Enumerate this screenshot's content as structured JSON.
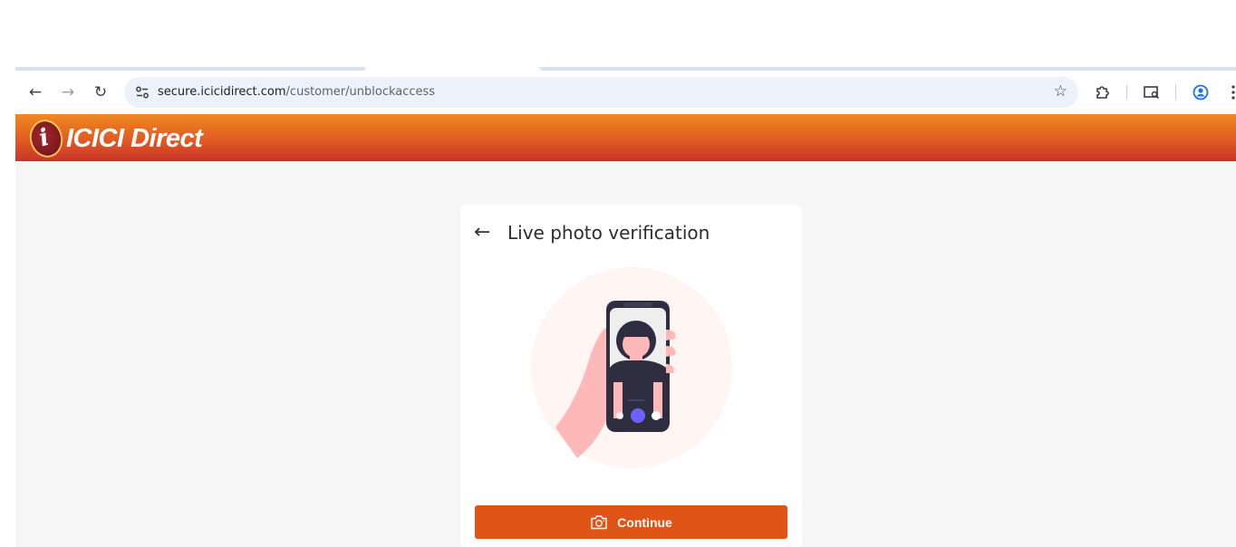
{
  "browser": {
    "url_host": "secure.icicidirect.com",
    "url_path": "/customer/unblockaccess",
    "icons": {
      "back": "back-arrow-icon",
      "forward": "forward-arrow-icon",
      "reload": "reload-icon",
      "site_info": "tune-icon",
      "bookmark": "star-icon",
      "extensions": "puzzle-icon",
      "tab_search": "tab-search-icon",
      "profile": "profile-icon",
      "menu": "kebab-menu-icon"
    }
  },
  "header": {
    "logo_text": "ICICI Direct",
    "logo_mark": "i",
    "gradient_colors": [
      "#ee8a22",
      "#c93428"
    ]
  },
  "card": {
    "title": "Live photo verification",
    "back_icon": "back-arrow-icon",
    "illustration": "person-taking-selfie-illustration",
    "continue_button": {
      "label": "Continue",
      "icon": "camera-icon",
      "color": "#e05417"
    }
  }
}
